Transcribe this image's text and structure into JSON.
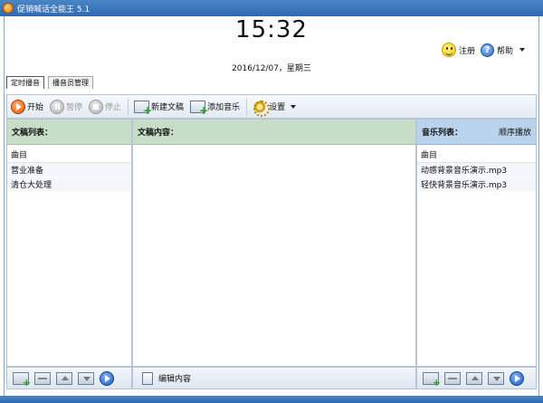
{
  "window": {
    "title": "促销喊话全能王 5.1"
  },
  "clock": {
    "time": "15:32",
    "date": "2016/12/07，星期三"
  },
  "top_right": {
    "register_label": "注册",
    "help_label": "帮助"
  },
  "tabs": [
    {
      "label": "定时播音"
    },
    {
      "label": "播音员管理"
    }
  ],
  "toolbar": {
    "start_label": "开始",
    "pause_label": "暂停",
    "stop_label": "停止",
    "new_doc_label": "新建文稿",
    "add_music_label": "添加音乐",
    "settings_label": "设置"
  },
  "left_panel": {
    "title": "文稿列表：",
    "column": "曲目",
    "items": [
      "营业准备",
      "清仓大处理"
    ]
  },
  "mid_panel": {
    "title": "文稿内容：",
    "bottom_label": "编辑内容"
  },
  "right_panel": {
    "title": "音乐列表：",
    "mode": "顺序播放",
    "column": "曲目",
    "items": [
      "动感背景音乐演示.mp3",
      "轻快背景音乐演示.mp3"
    ]
  }
}
